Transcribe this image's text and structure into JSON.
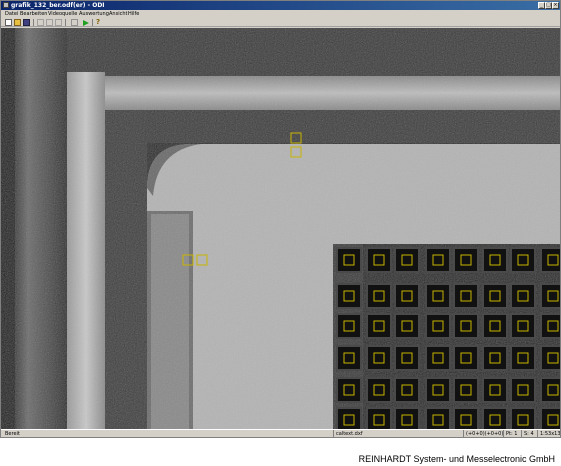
{
  "window": {
    "title": "grafik_132_ber.odf(er) - ODI"
  },
  "menu": [
    "Datei",
    "Bearbeiten",
    "Videoquelle",
    "Auswertung",
    "Ansicht",
    "Hilfe"
  ],
  "toolbar": {
    "icons": [
      "new-icon",
      "open-icon",
      "save-icon",
      "cut-icon",
      "copy-icon",
      "paste-icon",
      "stop-icon",
      "play-icon",
      "help-icon"
    ]
  },
  "statusbar": {
    "ready": "Bereit",
    "mode": "caltext.dxf",
    "coords": "(+0+0)(+0+0)",
    "pt": "Pt: 1",
    "scale": "S: 4",
    "zoom": "1:53x135"
  },
  "footer": {
    "company": "REINHARDT System- und Messelectronic GmbH"
  },
  "colors": {
    "marker": "#c8b400",
    "titlebar_start": "#0a246a",
    "titlebar_end": "#3a6ea5"
  }
}
